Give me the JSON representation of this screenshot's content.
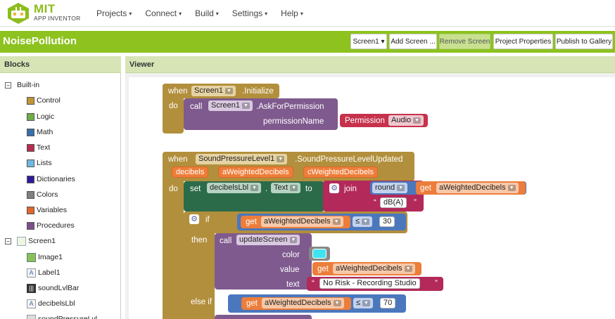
{
  "app": {
    "logo_title": "MIT",
    "logo_subtitle": "APP INVENTOR"
  },
  "menu": {
    "items": [
      {
        "label": "Projects"
      },
      {
        "label": "Connect"
      },
      {
        "label": "Build"
      },
      {
        "label": "Settings"
      },
      {
        "label": "Help"
      }
    ],
    "caret": "▾"
  },
  "project": {
    "name": "NoisePollution",
    "screen_select": "Screen1 ▾",
    "add_screen": "Add Screen ...",
    "remove_screen": "Remove Screen",
    "project_properties": "Project Properties",
    "publish": "Publish to Gallery"
  },
  "blocks_panel": {
    "title": "Blocks",
    "builtin": {
      "label": "Built-in",
      "toggle": "−",
      "items": [
        {
          "label": "Control",
          "color": "#c09538"
        },
        {
          "label": "Logic",
          "color": "#6fae47"
        },
        {
          "label": "Math",
          "color": "#3a6ea9"
        },
        {
          "label": "Text",
          "color": "#b42c4e"
        },
        {
          "label": "Lists",
          "color": "#71b8de"
        },
        {
          "label": "Dictionaries",
          "color": "#2d1a9b"
        },
        {
          "label": "Colors",
          "color": "#808080"
        },
        {
          "label": "Variables",
          "color": "#e0662e"
        },
        {
          "label": "Procedures",
          "color": "#7d4f8c"
        }
      ]
    },
    "screen": {
      "label": "Screen1",
      "toggle": "−",
      "components": [
        {
          "label": "Image1",
          "icon": "image-icon"
        },
        {
          "label": "Label1",
          "icon": "label-icon"
        },
        {
          "label": "soundLvlBar",
          "icon": "bar-icon"
        },
        {
          "label": "decibelsLbl",
          "icon": "label-icon"
        },
        {
          "label": "soundPressureLvl",
          "icon": "sensor-icon"
        }
      ]
    }
  },
  "viewer": {
    "title": "Viewer"
  },
  "blocks": {
    "init": {
      "when": "when",
      "component": "Screen1",
      "event": ".Initialize",
      "do": "do",
      "call": "call",
      "call_component": "Screen1",
      "method": ".AskForPermission",
      "param_name": "permissionName",
      "permission": "Permission",
      "permission_value": "Audio"
    },
    "sound": {
      "when": "when",
      "component": "SoundPressureLevel1",
      "event": ".SoundPressureLevelUpdated",
      "params": [
        "decibels",
        "aWeightedDecibels",
        "cWeightedDecibels"
      ],
      "do": "do",
      "set": "set",
      "set_component": "decibelsLbl",
      "dot": ".",
      "set_property": "Text",
      "to": "to",
      "join": "join",
      "round": "round",
      "get": "get",
      "get_var": "aWeightedDecibels",
      "text_open": "“",
      "unit_text": "dB(A)",
      "text_close": "”",
      "if": "if",
      "op": "≤",
      "threshold1": "30",
      "then": "then",
      "call": "call",
      "procedure": "updateScreen",
      "arg_color": "color",
      "color_value": "#40e4f0",
      "arg_value": "value",
      "arg_text": "text",
      "text_value": "No Risk - Recording Studio",
      "else_if": "else if",
      "threshold2": "70"
    }
  },
  "colors": {
    "brand_green": "#8dc21f",
    "control": "#b28f3c",
    "procedure": "#7f5a8e",
    "component_set": "#2b6b4a",
    "text_block": "#b3295a",
    "math": "#4b77bd",
    "variable": "#ec7d3b"
  }
}
